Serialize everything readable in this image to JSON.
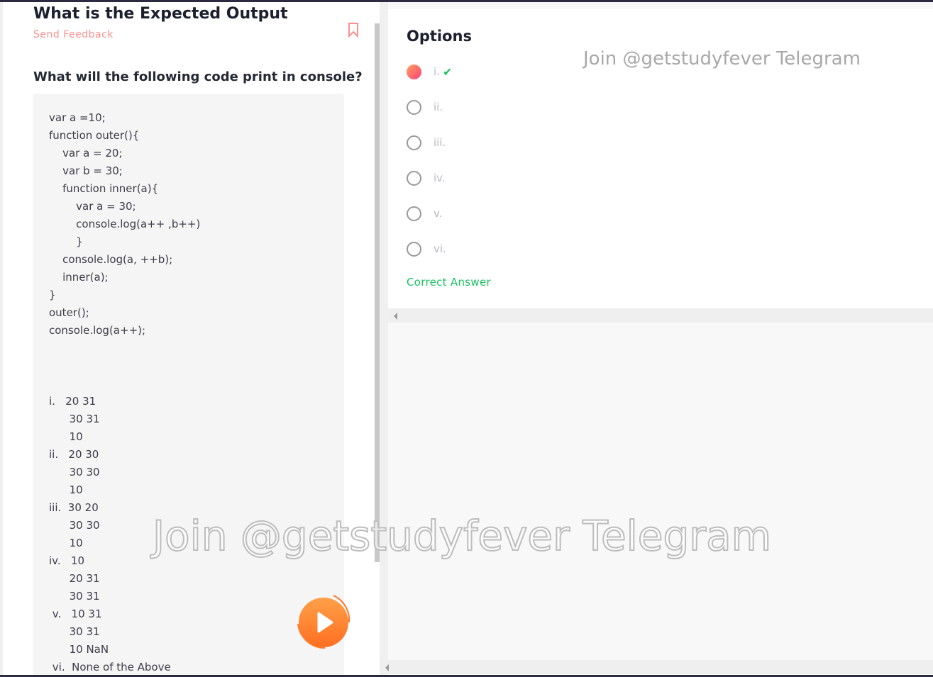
{
  "question": {
    "title": "What is the Expected Output",
    "feedback": "Send Feedback",
    "prompt": "What will the following code print in console?",
    "code": [
      "var a =10;",
      "function outer(){",
      "    var a = 20;",
      "    var b = 30;",
      "    function inner(a){",
      "        var a = 30;",
      "        console.log(a++ ,b++)",
      "        }",
      "    console.log(a, ++b);",
      "    inner(a);",
      "}",
      "outer();",
      "console.log(a++);"
    ],
    "answers": [
      "i.   20 31",
      "      30 31",
      "      10",
      "ii.   20 30",
      "      30 30",
      "      10",
      "iii.  30 20",
      "      30 30",
      "      10",
      "iv.   10",
      "      20 31",
      "      30 31",
      " v.   10 31",
      "      30 31",
      "      10 NaN",
      " vi.  None of the Above"
    ]
  },
  "options": {
    "title": "Options",
    "items": [
      {
        "label": "i.",
        "selected": true,
        "correct": true
      },
      {
        "label": "ii."
      },
      {
        "label": "iii."
      },
      {
        "label": "iv."
      },
      {
        "label": "v."
      },
      {
        "label": "vi."
      }
    ],
    "correct_label": "Correct Answer"
  },
  "watermark": "Join @getstudyfever Telegram",
  "colors": {
    "accent": "#ff8f8f",
    "correct": "#19c25f",
    "play": "#ff7a2a"
  }
}
